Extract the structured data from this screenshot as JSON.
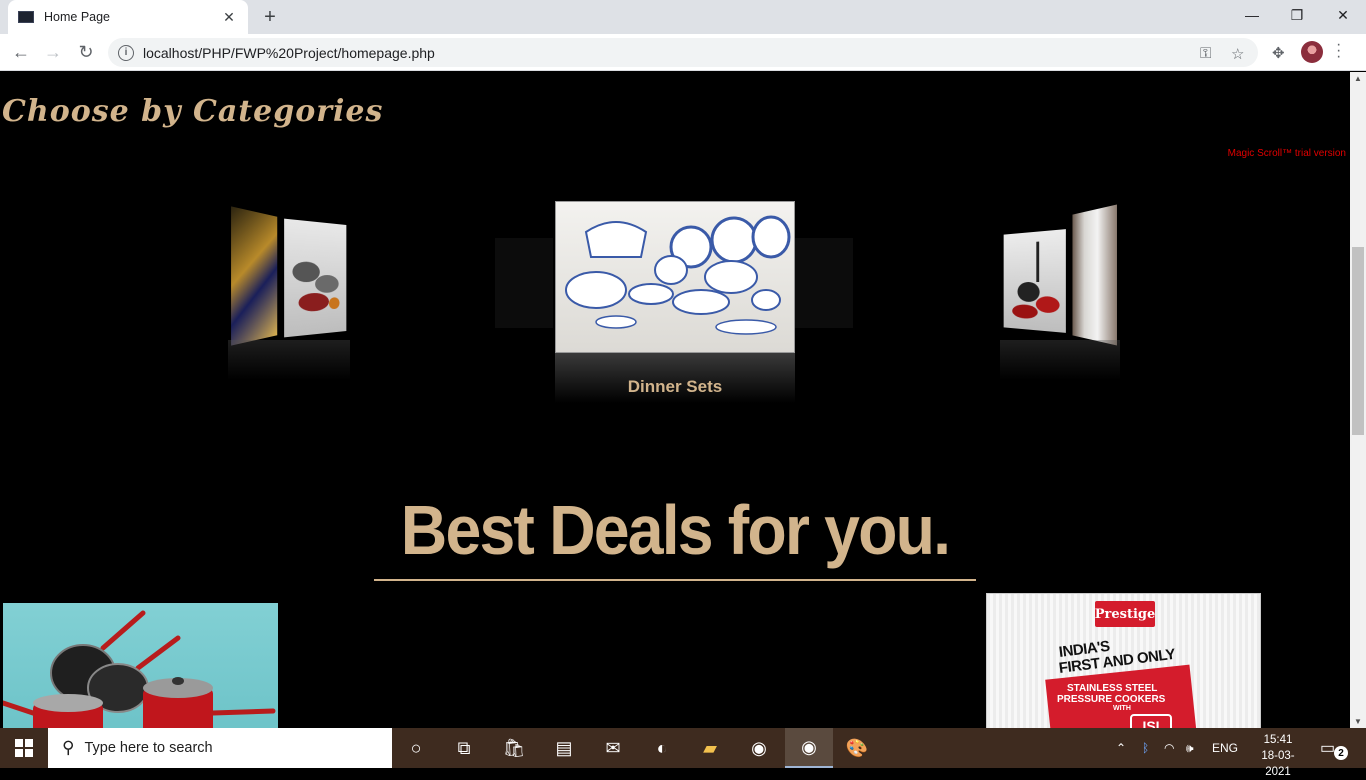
{
  "browser": {
    "tab_title": "Home Page",
    "url": "localhost/PHP/FWP%20Project/homepage.php"
  },
  "page": {
    "categories_heading": "Choose by Categories",
    "trial_notice": "Magic Scroll™ trial version",
    "carousel_caption": "Dinner Sets",
    "deals_heading": "Best Deals for you."
  },
  "ads": {
    "prestige": {
      "logo": "Prestige",
      "line1": "INDIA'S",
      "line2": "FIRST AND ONLY",
      "line3": "STAINLESS STEEL",
      "line4": "PRESSURE COOKERS",
      "line5": "WITH",
      "mark": "ISI"
    }
  },
  "taskbar": {
    "search_placeholder": "Type here to search",
    "language": "ENG",
    "time": "15:41",
    "date": "18-03-2021",
    "notification_count": "2"
  },
  "colors": {
    "accent_tan": "#d2b48c",
    "trial_red": "#e00000",
    "taskbar": "#3e2b1f"
  }
}
